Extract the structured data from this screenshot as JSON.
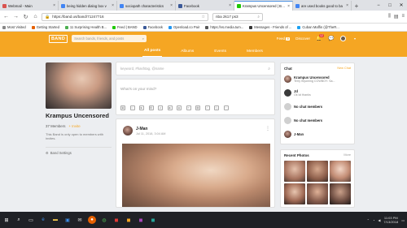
{
  "browser": {
    "tabs": [
      {
        "label": "Webmail - Main",
        "active": false,
        "favicon_color": "#d9534f"
      },
      {
        "label": "being hidden dialog box v",
        "active": false,
        "favicon_color": "#4285f4"
      },
      {
        "label": "sociopath characteristics",
        "active": false,
        "favicon_color": "#4285f4"
      },
      {
        "label": "Facebook",
        "active": false,
        "favicon_color": "#3b5998"
      },
      {
        "label": "Krampus Uncensored | BAND",
        "active": true,
        "favicon_color": "#1ec800"
      },
      {
        "label": "are used books good to ba",
        "active": false,
        "favicon_color": "#4285f4"
      }
    ],
    "url": "https://band.us/band/71247716",
    "search_query": "nba 2k17 ps3",
    "bookmarks": [
      {
        "label": "Most Visited",
        "color": "#888"
      },
      {
        "label": "Getting Started",
        "color": "#e66000"
      },
      {
        "label": "11 Surprising Health B...",
        "color": "#4caf50"
      },
      {
        "label": "Feed | BAND",
        "color": "#1ec800"
      },
      {
        "label": "Facebook",
        "color": "#3b5998"
      },
      {
        "label": "Openload.co Pair",
        "color": "#2196f3"
      },
      {
        "label": "https://vs.media.tum...",
        "color": "#555"
      },
      {
        "label": "Messages - Friends of ...",
        "color": "#333"
      },
      {
        "label": "Cuban Maffin (@TheR...",
        "color": "#1da1f2"
      }
    ]
  },
  "band": {
    "logo": "BAND",
    "search_placeholder": "Search bands, friends, and posts",
    "nav": {
      "feed": "Feed",
      "feed_badge": "9",
      "discover": "Discover",
      "notif_badge": "12"
    },
    "tabs": [
      "All posts",
      "Albums",
      "Events",
      "Members"
    ],
    "name": "Krampus Uncensored",
    "members": "37 Members",
    "invite": "Invite",
    "note": "This Band is only open to members with invites.",
    "settings": "Band Settings",
    "post_search_placeholder": "keyword, #hashtag, @name",
    "compose_placeholder": "What's on your mind?",
    "post": {
      "author": "J-Man",
      "date": "Jul 11, 2018, 3:04 AM"
    },
    "chat": {
      "title": "Chat",
      "new_chat": "New Chat",
      "items": [
        {
          "name": "Krampus Uncensored",
          "sub": "Terry Wyoming COWBOY: Sa..."
        },
        {
          "name": "Jd",
          "sub": "Ok lol thanks"
        },
        {
          "name": "No chat members",
          "sub": ""
        },
        {
          "name": "No chat members",
          "sub": ""
        },
        {
          "name": "J-Man",
          "sub": ""
        }
      ]
    },
    "photos": {
      "title": "Recent Photos",
      "more": "More"
    }
  },
  "taskbar": {
    "time": "11:03 PM",
    "date": "7/13/2018"
  }
}
